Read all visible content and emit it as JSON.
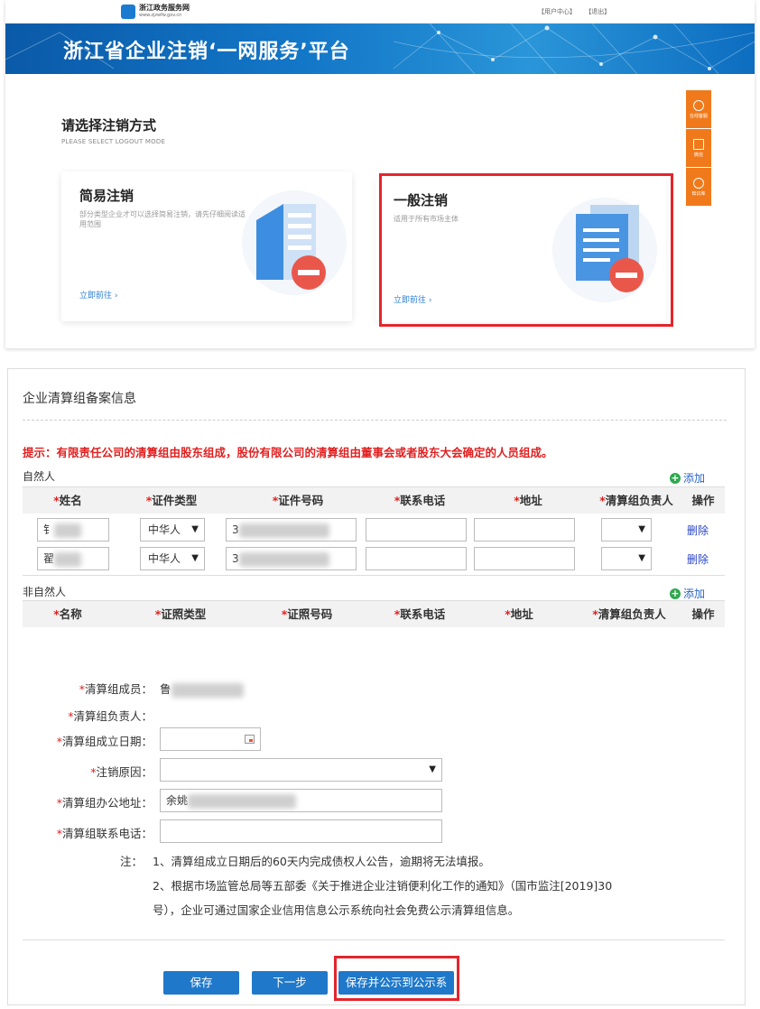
{
  "header": {
    "logo_name": "浙江政务服务网",
    "logo_url": "www.zjzwfw.gov.cn",
    "links": [
      "【用户中心】",
      "【退出】"
    ],
    "banner_title": "浙江省企业注销‘一网服务’平台"
  },
  "select_mode": {
    "title": "请选择注销方式",
    "subtitle": "PLEASE SELECT LOGOUT MODE",
    "cards": [
      {
        "title": "简易注销",
        "desc": "部分类型企业才可以选择简易注销，请先仔细阅读适用范围",
        "link": "立即前往 ›"
      },
      {
        "title": "一般注销",
        "desc": "适用于所有市场主体",
        "link": "立即前往 ›"
      }
    ]
  },
  "side_tools": [
    {
      "icon": "headset-icon",
      "label": "在线客服"
    },
    {
      "icon": "qrcode-icon",
      "label": "微信"
    },
    {
      "icon": "compass-icon",
      "label": "知识库"
    }
  ],
  "form": {
    "section_title": "企业清算组备案信息",
    "hint": "提示：有限责任公司的清算组由股东组成，股份有限公司的清算组由董事会或者股东大会确定的人员组成。",
    "natural": {
      "label": "自然人",
      "add_label": "添加",
      "columns": [
        "姓名",
        "证件类型",
        "证件号码",
        "联系电话",
        "地址",
        "清算组负责人",
        "操作"
      ],
      "rows": [
        {
          "name": "钅",
          "id_type": "中华人",
          "id_no": "3",
          "phone": "",
          "address": "",
          "leader": "",
          "action": "删除"
        },
        {
          "name": "翟",
          "id_type": "中华人",
          "id_no": "3",
          "phone": "",
          "address": "",
          "leader": "",
          "action": "删除"
        }
      ]
    },
    "non_natural": {
      "label": "非自然人",
      "add_label": "添加",
      "columns": [
        "名称",
        "证照类型",
        "证照号码",
        "联系电话",
        "地址",
        "清算组负责人",
        "操作"
      ]
    },
    "fields": {
      "members_label": "清算组成员：",
      "members_value": "鲁",
      "leader_label": "清算组负责人：",
      "date_label": "清算组成立日期：",
      "reason_label": "注销原因：",
      "address_label": "清算组办公地址：",
      "address_value": "余姚",
      "phone_label": "清算组联系电话："
    },
    "notes": {
      "prefix": "注：",
      "line1": "1、清算组成立日期后的60天内完成债权人公告，逾期将无法填报。",
      "line2": "2、根据市场监管总局等五部委《关于推进企业注销便利化工作的通知》（国市监注[2019]30",
      "line3": "号），企业可通过国家企业信用信息公示系统向社会免费公示清算组信息。"
    },
    "buttons": {
      "save": "保存",
      "next": "下一步",
      "save_publish": "保存并公示到公示系"
    }
  },
  "colors": {
    "banner": "#1377c8",
    "required": "#e02020",
    "button": "#1f78c9",
    "highlight_frame": "#e2262c",
    "side_tool": "#f07a1b"
  }
}
